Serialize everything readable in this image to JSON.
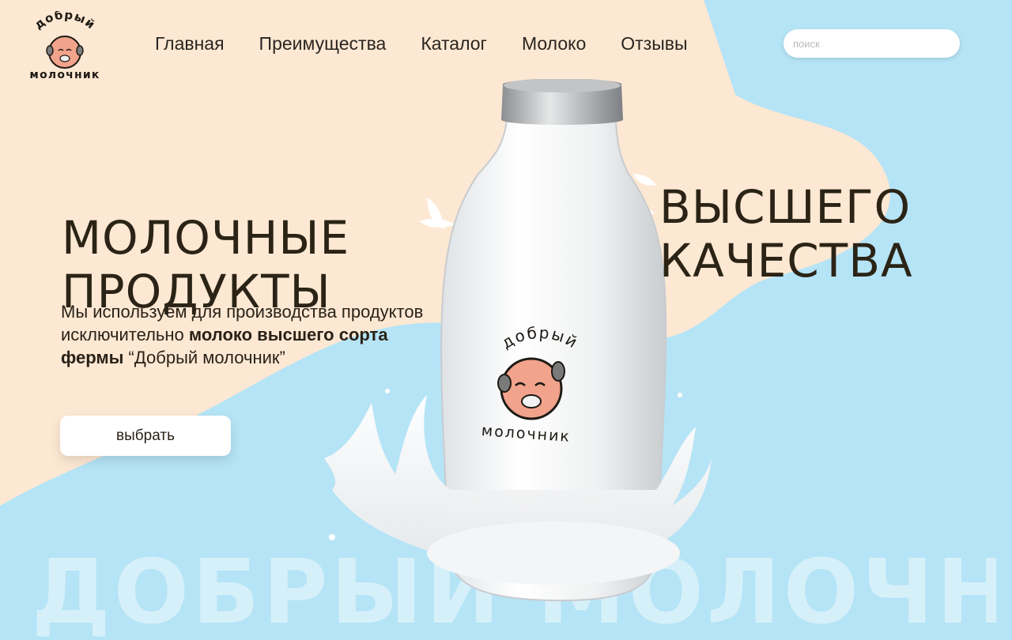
{
  "brand": {
    "logo_top": "добрый",
    "logo_bottom": "молочник"
  },
  "nav": {
    "items": [
      "Главная",
      "Преимущества",
      "Каталог",
      "Молоко",
      "Отзывы"
    ]
  },
  "search": {
    "placeholder": "поиск",
    "value": ""
  },
  "hero": {
    "title_left": [
      "МОЛОЧНЫЕ",
      "ПРОДУКТЫ"
    ],
    "title_right": [
      "ВЫСШЕГО",
      "КАЧЕСТВА"
    ],
    "description": {
      "part1": "Мы используем для производства продуктов исключительно ",
      "bold": "молоко высшего сорта фермы",
      "part2": " “Добрый молочник”"
    },
    "button_label": "выбрать"
  },
  "bottle_label": {
    "top": "добрый",
    "bottom": "молочник"
  },
  "watermark": "ДОБРЫЙ МОЛОЧНИК",
  "colors": {
    "peach": "#fde8d3",
    "sky": "#b5e4f6",
    "text": "#2b2416"
  }
}
